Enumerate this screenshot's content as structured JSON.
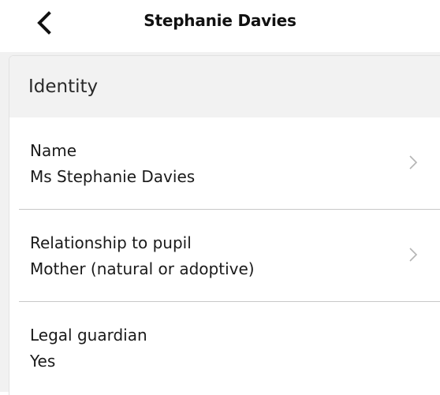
{
  "header": {
    "title": "Stephanie Davies",
    "back_icon": "chevron-left-icon"
  },
  "identity": {
    "section_title": "Identity",
    "rows": [
      {
        "label": "Name",
        "value": "Ms Stephanie Davies",
        "navigable": true
      },
      {
        "label": "Relationship to pupil",
        "value": "Mother (natural or adoptive)",
        "navigable": true
      },
      {
        "label": "Legal guardian",
        "value": "Yes",
        "navigable": false
      }
    ]
  },
  "colors": {
    "text": "#1a1a1a",
    "section_bg": "#f2f2f2",
    "divider": "#c8c8c8",
    "chevron": "#b4b4b4"
  }
}
